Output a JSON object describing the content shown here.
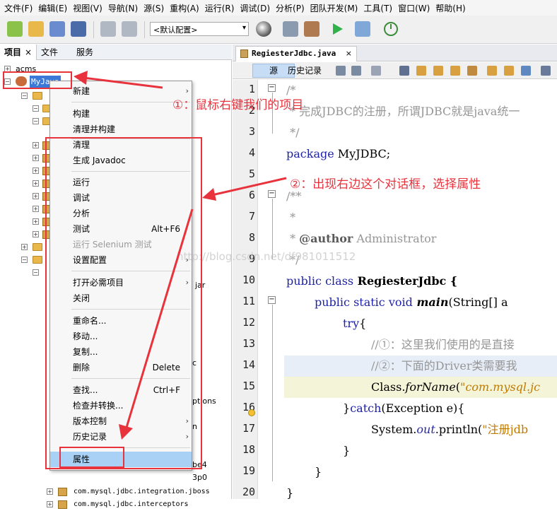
{
  "menubar": [
    "文件(F)",
    "编辑(E)",
    "视图(V)",
    "导航(N)",
    "源(S)",
    "重构(A)",
    "运行(R)",
    "调试(D)",
    "分析(P)",
    "团队开发(M)",
    "工具(T)",
    "窗口(W)",
    "帮助(H)"
  ],
  "toolbar": {
    "config": "<默认配置>"
  },
  "left_tabs": {
    "projects": "项目",
    "files": "文件",
    "services": "服务",
    "close": "×"
  },
  "tree": {
    "project1": "acms",
    "project2": "MyJava",
    "fragments": {
      "jar": "jar",
      "c": "c",
      "ptions": "ptions",
      "n": "n",
      "be4": "be4",
      "3p0": "3p0",
      "integration": "com.mysql.jdbc.integration.jboss",
      "interceptors": "com.mysql.jdbc.interceptors"
    }
  },
  "context_menu": {
    "new": "新建",
    "build": "构建",
    "clean_build": "清理并构建",
    "clean": "清理",
    "javadoc": "生成 Javadoc",
    "run": "运行",
    "debug": "调试",
    "profile": "分析",
    "test": "测试",
    "test_shortcut": "Alt+F6",
    "selenium": "运行 Selenium 测试",
    "set_config": "设置配置",
    "open_required": "打开必需项目",
    "close": "关闭",
    "rename": "重命名...",
    "move": "移动...",
    "copy": "复制...",
    "delete": "删除",
    "delete_shortcut": "Delete",
    "find": "查找...",
    "find_shortcut": "Ctrl+F",
    "inspect": "检查并转换...",
    "vcs": "版本控制",
    "history": "历史记录",
    "properties": "属性",
    "submenu_arrow": "›"
  },
  "editor": {
    "tab_label": "RegiesterJdbc.java",
    "tab_close": "×",
    "source_tab": "源",
    "history_tab": "历史记录",
    "line_numbers": [
      "1",
      "2",
      "3",
      "4",
      "5",
      "6",
      "7",
      "8",
      "9",
      "10",
      "11",
      "12",
      "13",
      "14",
      "15",
      "16",
      "17",
      "18",
      "19",
      "20"
    ],
    "code": {
      "l1": "/*",
      "l2": " * 完成JDBC的注册，所谓JDBC就是java统一",
      "l3": " */",
      "l4_kw": "package",
      "l4_rest": " MyJDBC;",
      "l6": "/**",
      "l7": " *",
      "l8_a": " * ",
      "l8_tag": "@author",
      "l8_b": " Administrator",
      "l9": " */",
      "l10_kw": "public class",
      "l10_rest": " RegiesterJdbc {",
      "l11_kw": "public static void",
      "l11_m": " main",
      "l11_rest": "(String[] a",
      "l12_kw": "try",
      "l12_rest": "{",
      "l13": "//①：这里我们使用的是直接",
      "l14": "//②：下面的Driver类需要我",
      "l15_a": "Class.",
      "l15_m": "forName",
      "l15_b": "(",
      "l15_str": "\"com.mysql.jc",
      "l16_a": "}",
      "l16_kw": "catch",
      "l16_b": "(Exception e){",
      "l17_a": "System.",
      "l17_out": "out",
      "l17_b": ".println(",
      "l17_str": "\"注册jdb",
      "l18": "}",
      "l19": "}",
      "l20": "}"
    }
  },
  "annotations": {
    "step1": "①：鼠标右键我们的项目",
    "step2": "②：出现右边这个对话框，选择属性",
    "watermark": "http://blog.csdn.net/df981011512"
  },
  "colors": {
    "annotation_red": "#e8323c",
    "selection_blue": "#3b78d8",
    "menu_highlight": "#a9d1f5"
  }
}
